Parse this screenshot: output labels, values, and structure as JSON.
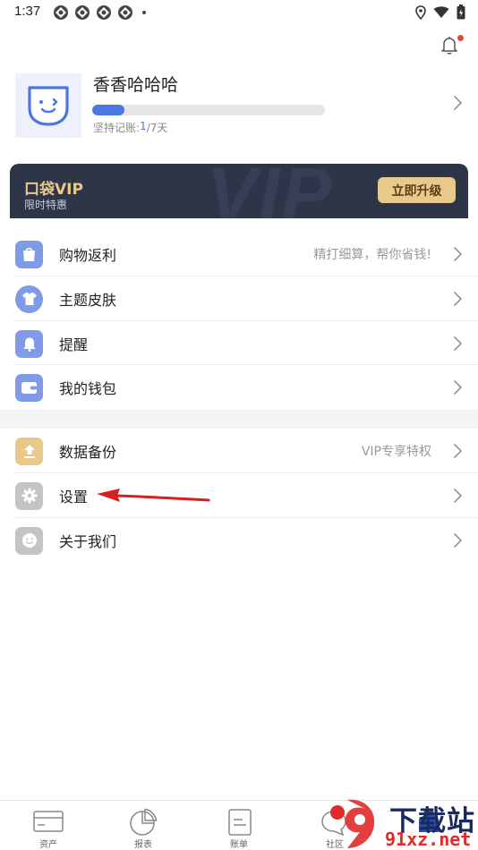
{
  "status_bar": {
    "time": "1:37"
  },
  "profile": {
    "username": "香香哈哈哈",
    "streak_label": "坚持记账:",
    "streak_current": "1",
    "streak_total": "/7天",
    "streak_progress": 0.14
  },
  "vip": {
    "title": "口袋VIP",
    "subtitle": "限时特惠",
    "upgrade_label": "立即升级",
    "watermark": "VIP"
  },
  "menu_group1": [
    {
      "label": "购物返利",
      "hint": "精打细算，帮你省钱!",
      "icon": "shopping-bag-icon",
      "color": "#7f9be8"
    },
    {
      "label": "主题皮肤",
      "hint": "",
      "icon": "tshirt-icon",
      "color": "#7f9be8"
    },
    {
      "label": "提醒",
      "hint": "",
      "icon": "bell-icon",
      "color": "#7f9be8"
    },
    {
      "label": "我的钱包",
      "hint": "",
      "icon": "wallet-icon",
      "color": "#7f9be8"
    }
  ],
  "menu_group2": [
    {
      "label": "数据备份",
      "hint": "VIP专享特权",
      "icon": "upload-icon",
      "color": "#e9c98a"
    },
    {
      "label": "设置",
      "hint": "",
      "icon": "gear-icon",
      "color": "#c4c4c4"
    },
    {
      "label": "关于我们",
      "hint": "",
      "icon": "smiley-icon",
      "color": "#c4c4c4"
    }
  ],
  "bottom_nav": [
    {
      "label": "资产",
      "icon": "card-icon"
    },
    {
      "label": "报表",
      "icon": "pie-chart-icon"
    },
    {
      "label": "账单",
      "icon": "bill-icon"
    },
    {
      "label": "社区",
      "icon": "chat-icon"
    }
  ],
  "watermark": {
    "title": "下载站",
    "url": "91xz.net"
  },
  "colors": {
    "accent": "#4a78e0",
    "vip_dark": "#2f3548",
    "vip_gold": "#e8c98c",
    "alert_red": "#e8443a"
  }
}
